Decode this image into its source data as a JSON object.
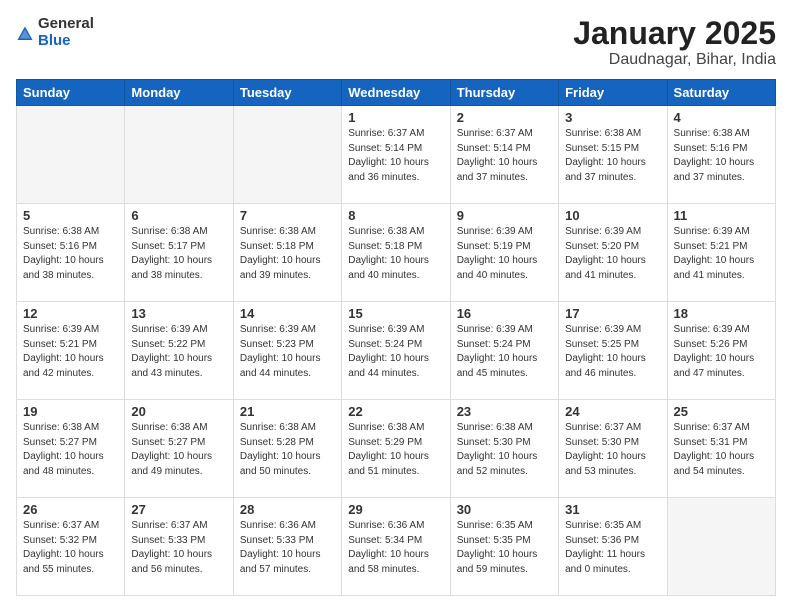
{
  "header": {
    "logo": {
      "general": "General",
      "blue": "Blue"
    },
    "title": "January 2025",
    "subtitle": "Daudnagar, Bihar, India"
  },
  "weekdays": [
    "Sunday",
    "Monday",
    "Tuesday",
    "Wednesday",
    "Thursday",
    "Friday",
    "Saturday"
  ],
  "weeks": [
    [
      {
        "day": "",
        "info": ""
      },
      {
        "day": "",
        "info": ""
      },
      {
        "day": "",
        "info": ""
      },
      {
        "day": "1",
        "info": "Sunrise: 6:37 AM\nSunset: 5:14 PM\nDaylight: 10 hours\nand 36 minutes."
      },
      {
        "day": "2",
        "info": "Sunrise: 6:37 AM\nSunset: 5:14 PM\nDaylight: 10 hours\nand 37 minutes."
      },
      {
        "day": "3",
        "info": "Sunrise: 6:38 AM\nSunset: 5:15 PM\nDaylight: 10 hours\nand 37 minutes."
      },
      {
        "day": "4",
        "info": "Sunrise: 6:38 AM\nSunset: 5:16 PM\nDaylight: 10 hours\nand 37 minutes."
      }
    ],
    [
      {
        "day": "5",
        "info": "Sunrise: 6:38 AM\nSunset: 5:16 PM\nDaylight: 10 hours\nand 38 minutes."
      },
      {
        "day": "6",
        "info": "Sunrise: 6:38 AM\nSunset: 5:17 PM\nDaylight: 10 hours\nand 38 minutes."
      },
      {
        "day": "7",
        "info": "Sunrise: 6:38 AM\nSunset: 5:18 PM\nDaylight: 10 hours\nand 39 minutes."
      },
      {
        "day": "8",
        "info": "Sunrise: 6:38 AM\nSunset: 5:18 PM\nDaylight: 10 hours\nand 40 minutes."
      },
      {
        "day": "9",
        "info": "Sunrise: 6:39 AM\nSunset: 5:19 PM\nDaylight: 10 hours\nand 40 minutes."
      },
      {
        "day": "10",
        "info": "Sunrise: 6:39 AM\nSunset: 5:20 PM\nDaylight: 10 hours\nand 41 minutes."
      },
      {
        "day": "11",
        "info": "Sunrise: 6:39 AM\nSunset: 5:21 PM\nDaylight: 10 hours\nand 41 minutes."
      }
    ],
    [
      {
        "day": "12",
        "info": "Sunrise: 6:39 AM\nSunset: 5:21 PM\nDaylight: 10 hours\nand 42 minutes."
      },
      {
        "day": "13",
        "info": "Sunrise: 6:39 AM\nSunset: 5:22 PM\nDaylight: 10 hours\nand 43 minutes."
      },
      {
        "day": "14",
        "info": "Sunrise: 6:39 AM\nSunset: 5:23 PM\nDaylight: 10 hours\nand 44 minutes."
      },
      {
        "day": "15",
        "info": "Sunrise: 6:39 AM\nSunset: 5:24 PM\nDaylight: 10 hours\nand 44 minutes."
      },
      {
        "day": "16",
        "info": "Sunrise: 6:39 AM\nSunset: 5:24 PM\nDaylight: 10 hours\nand 45 minutes."
      },
      {
        "day": "17",
        "info": "Sunrise: 6:39 AM\nSunset: 5:25 PM\nDaylight: 10 hours\nand 46 minutes."
      },
      {
        "day": "18",
        "info": "Sunrise: 6:39 AM\nSunset: 5:26 PM\nDaylight: 10 hours\nand 47 minutes."
      }
    ],
    [
      {
        "day": "19",
        "info": "Sunrise: 6:38 AM\nSunset: 5:27 PM\nDaylight: 10 hours\nand 48 minutes."
      },
      {
        "day": "20",
        "info": "Sunrise: 6:38 AM\nSunset: 5:27 PM\nDaylight: 10 hours\nand 49 minutes."
      },
      {
        "day": "21",
        "info": "Sunrise: 6:38 AM\nSunset: 5:28 PM\nDaylight: 10 hours\nand 50 minutes."
      },
      {
        "day": "22",
        "info": "Sunrise: 6:38 AM\nSunset: 5:29 PM\nDaylight: 10 hours\nand 51 minutes."
      },
      {
        "day": "23",
        "info": "Sunrise: 6:38 AM\nSunset: 5:30 PM\nDaylight: 10 hours\nand 52 minutes."
      },
      {
        "day": "24",
        "info": "Sunrise: 6:37 AM\nSunset: 5:30 PM\nDaylight: 10 hours\nand 53 minutes."
      },
      {
        "day": "25",
        "info": "Sunrise: 6:37 AM\nSunset: 5:31 PM\nDaylight: 10 hours\nand 54 minutes."
      }
    ],
    [
      {
        "day": "26",
        "info": "Sunrise: 6:37 AM\nSunset: 5:32 PM\nDaylight: 10 hours\nand 55 minutes."
      },
      {
        "day": "27",
        "info": "Sunrise: 6:37 AM\nSunset: 5:33 PM\nDaylight: 10 hours\nand 56 minutes."
      },
      {
        "day": "28",
        "info": "Sunrise: 6:36 AM\nSunset: 5:33 PM\nDaylight: 10 hours\nand 57 minutes."
      },
      {
        "day": "29",
        "info": "Sunrise: 6:36 AM\nSunset: 5:34 PM\nDaylight: 10 hours\nand 58 minutes."
      },
      {
        "day": "30",
        "info": "Sunrise: 6:35 AM\nSunset: 5:35 PM\nDaylight: 10 hours\nand 59 minutes."
      },
      {
        "day": "31",
        "info": "Sunrise: 6:35 AM\nSunset: 5:36 PM\nDaylight: 11 hours\nand 0 minutes."
      },
      {
        "day": "",
        "info": ""
      }
    ]
  ]
}
